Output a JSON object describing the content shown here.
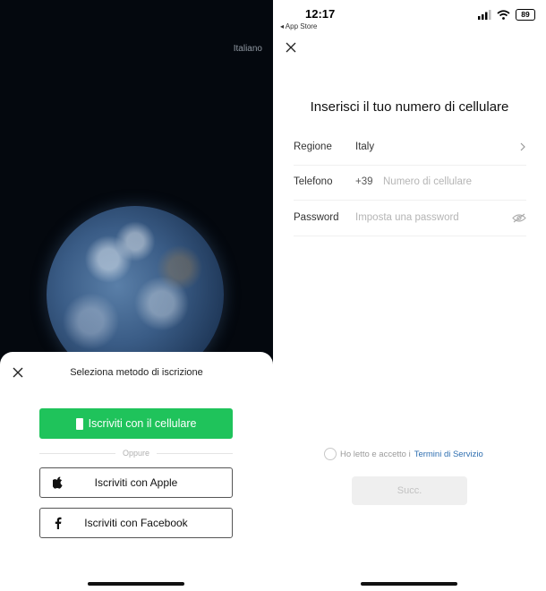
{
  "left_screen": {
    "language_link": "Italiano",
    "sheet": {
      "title": "Seleziona metodo di iscrizione",
      "phone_button": "Iscriviti con il cellulare",
      "divider": "Oppure",
      "apple_button": "Iscriviti con Apple",
      "facebook_button": "Iscriviti con Facebook"
    }
  },
  "right_screen": {
    "status_bar": {
      "time": "12:17",
      "back_app": "◂ App Store",
      "battery": "89"
    },
    "title": "Inserisci il tuo numero di cellulare",
    "fields": {
      "region_label": "Regione",
      "region_value": "Italy",
      "phone_label": "Telefono",
      "phone_prefix": "+39",
      "phone_placeholder": "Numero di cellulare",
      "password_label": "Password",
      "password_placeholder": "Imposta una password"
    },
    "terms": {
      "text": "Ho letto e accetto i",
      "link": "Termini di Servizio"
    },
    "next_button": "Succ."
  },
  "colors": {
    "accent_green": "#1fc35b",
    "link_blue": "#2f6fb0",
    "dark_background": "#04080e"
  },
  "icons": [
    "close-icon",
    "phone-icon",
    "apple-icon",
    "facebook-icon",
    "chevron-right-icon",
    "eye-off-icon",
    "signal-icon",
    "wifi-icon",
    "battery-icon"
  ]
}
